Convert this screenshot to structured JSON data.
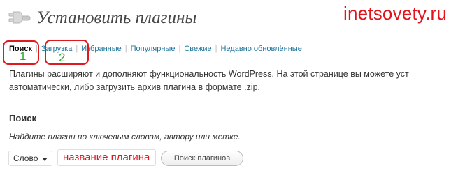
{
  "header": {
    "title": "Установить плагины",
    "watermark": "inetsovety.ru"
  },
  "tabs": [
    {
      "label": "Поиск",
      "current": true
    },
    {
      "label": "Загрузка",
      "current": false
    },
    {
      "label": "Избранные",
      "current": false
    },
    {
      "label": "Популярные",
      "current": false
    },
    {
      "label": "Свежие",
      "current": false
    },
    {
      "label": "Недавно обновлённые",
      "current": false
    }
  ],
  "tab_separator": "|",
  "annotations": {
    "marker_1": "1",
    "marker_2": "2"
  },
  "intro": {
    "line1": "Плагины расширяют и дополняют функциональность WordPress. На этой странице вы можете уст",
    "line2": "автоматически, либо загрузить архив плагина в формате .zip."
  },
  "search": {
    "heading": "Поиск",
    "hint": "Найдите плагин по ключевым словам, автору или метке.",
    "type_selected": "Слово",
    "input_value": "название плагина",
    "button_label": "Поиск плагинов"
  },
  "colors": {
    "link": "#21759b",
    "annotation_red": "#e0181f",
    "annotation_green": "#2fa52f"
  },
  "icons": {
    "title_icon": "plugin-plug-icon",
    "select_caret": "chevron-down-icon"
  }
}
